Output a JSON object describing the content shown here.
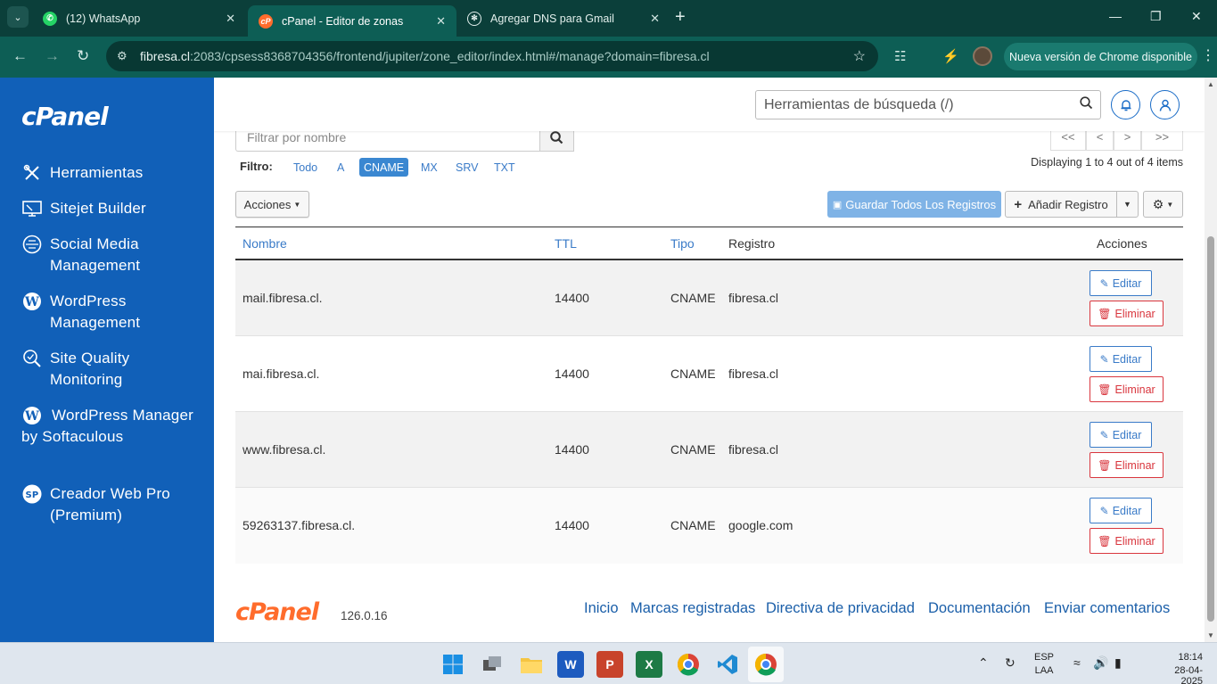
{
  "browser": {
    "tabs": [
      {
        "title": "(12) WhatsApp",
        "icon": "whatsapp-icon",
        "active": false
      },
      {
        "title": "cPanel - Editor de zonas",
        "icon": "cpanel-icon",
        "active": true
      },
      {
        "title": "Agregar DNS para Gmail",
        "icon": "openai-icon",
        "active": false
      }
    ],
    "url_host": "fibresa.cl",
    "url_rest": ":2083/cpsess8368704356/frontend/jupiter/zone_editor/index.html#/manage?domain=fibresa.cl",
    "update_label": "Nueva versión de Chrome disponible"
  },
  "sidebar": {
    "logo": "cPanel",
    "items": [
      {
        "label": "Herramientas",
        "icon": "tools-icon"
      },
      {
        "label": "Sitejet Builder",
        "icon": "sitejet-icon"
      },
      {
        "label": "Social Media Management",
        "icon": "social-media-icon"
      },
      {
        "label": "WordPress Management",
        "icon": "wordpress-icon"
      },
      {
        "label": "Site Quality Monitoring",
        "icon": "site-quality-icon"
      },
      {
        "label": "WordPress Manager by Softaculous",
        "icon": "wordpress-icon"
      },
      {
        "label": "Creador Web Pro (Premium)",
        "icon": "sitepro-icon"
      }
    ]
  },
  "header": {
    "search_placeholder": "Herramientas de búsqueda (/)"
  },
  "zone": {
    "filter_placeholder": "Filtrar por nombre",
    "pager": [
      "<<",
      "<",
      ">",
      ">>"
    ],
    "displaying": "Displaying 1 to 4 out of 4 items",
    "filtro_label": "Filtro:",
    "filters": [
      "Todo",
      "A",
      "CNAME",
      "MX",
      "SRV",
      "TXT"
    ],
    "active_filter": "CNAME",
    "actions_label": "Acciones",
    "save_all_label": "Guardar Todos Los Registros",
    "add_record_label": "Añadir Registro",
    "columns": {
      "name": "Nombre",
      "ttl": "TTL",
      "type": "Tipo",
      "record": "Registro",
      "actions": "Acciones"
    },
    "edit_label": "Editar",
    "delete_label": "Eliminar",
    "rows": [
      {
        "name": "mail.fibresa.cl.",
        "ttl": "14400",
        "type": "CNAME",
        "record": "fibresa.cl"
      },
      {
        "name": "mai.fibresa.cl.",
        "ttl": "14400",
        "type": "CNAME",
        "record": "fibresa.cl"
      },
      {
        "name": "www.fibresa.cl.",
        "ttl": "14400",
        "type": "CNAME",
        "record": "fibresa.cl"
      },
      {
        "name": "59263137.fibresa.cl.",
        "ttl": "14400",
        "type": "CNAME",
        "record": "google.com"
      }
    ]
  },
  "footer": {
    "logo": "cPanel",
    "version": "126.0.16",
    "links": [
      "Inicio",
      "Marcas registradas",
      "Directiva de privacidad",
      "Documentación",
      "Enviar comentarios"
    ]
  },
  "taskbar": {
    "lang_top": "ESP",
    "lang_bottom": "LAA",
    "time": "18:14",
    "date": "28-04-2025"
  },
  "colors": {
    "sidebar": "#1160b8",
    "accent": "#3a7bc8",
    "danger": "#d9363e",
    "cpanel_orange": "#ff6c2c"
  }
}
